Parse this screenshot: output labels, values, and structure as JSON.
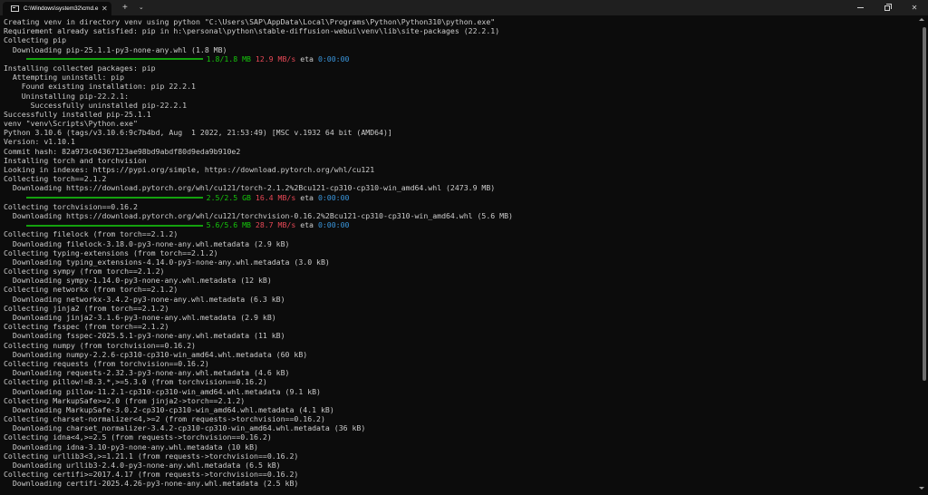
{
  "tab": {
    "title": "C:\\Windows\\system32\\cmd.e"
  },
  "titlebar": {
    "close_glyph": "✕",
    "new_tab_glyph": "+",
    "dropdown_glyph": "⌄",
    "win_close_glyph": "✕"
  },
  "console": {
    "l1": "Creating venv in directory venv using python \"C:\\Users\\SAP\\AppData\\Local\\Programs\\Python\\Python310\\python.exe\"",
    "l2": "Requirement already satisfied: pip in h:\\personal\\python\\stable-diffusion-webui\\venv\\lib\\site-packages (22.2.1)",
    "l3": "Collecting pip",
    "l4": "  Downloading pip-25.1.1-py3-none-any.whl (1.8 MB)",
    "p1": {
      "indent": "     ",
      "done": "1.8/1.8 MB",
      "speed": "12.9 MB/s",
      "eta_label": "eta",
      "eta": "0:00:00"
    },
    "l6": "Installing collected packages: pip",
    "l7": "  Attempting uninstall: pip",
    "l8": "    Found existing installation: pip 22.2.1",
    "l9": "    Uninstalling pip-22.2.1:",
    "l10": "      Successfully uninstalled pip-22.2.1",
    "l11": "Successfully installed pip-25.1.1",
    "l12": "venv \"venv\\Scripts\\Python.exe\"",
    "l13": "Python 3.10.6 (tags/v3.10.6:9c7b4bd, Aug  1 2022, 21:53:49) [MSC v.1932 64 bit (AMD64)]",
    "l14": "Version: v1.10.1",
    "l15": "Commit hash: 82a973c04367123ae98bd9abdf80d9eda9b910e2",
    "l16": "Installing torch and torchvision",
    "l17": "Looking in indexes: https://pypi.org/simple, https://download.pytorch.org/whl/cu121",
    "l18": "Collecting torch==2.1.2",
    "l19": "  Downloading https://download.pytorch.org/whl/cu121/torch-2.1.2%2Bcu121-cp310-cp310-win_amd64.whl (2473.9 MB)",
    "p2": {
      "indent": "     ",
      "done": "2.5/2.5 GB",
      "speed": "16.4 MB/s",
      "eta_label": "eta",
      "eta": "0:00:00"
    },
    "l21": "Collecting torchvision==0.16.2",
    "l22": "  Downloading https://download.pytorch.org/whl/cu121/torchvision-0.16.2%2Bcu121-cp310-cp310-win_amd64.whl (5.6 MB)",
    "p3": {
      "indent": "     ",
      "done": "5.6/5.6 MB",
      "speed": "28.7 MB/s",
      "eta_label": "eta",
      "eta": "0:00:00"
    },
    "l24": "Collecting filelock (from torch==2.1.2)",
    "l25": "  Downloading filelock-3.18.0-py3-none-any.whl.metadata (2.9 kB)",
    "l26": "Collecting typing-extensions (from torch==2.1.2)",
    "l27": "  Downloading typing_extensions-4.14.0-py3-none-any.whl.metadata (3.0 kB)",
    "l28": "Collecting sympy (from torch==2.1.2)",
    "l29": "  Downloading sympy-1.14.0-py3-none-any.whl.metadata (12 kB)",
    "l30": "Collecting networkx (from torch==2.1.2)",
    "l31": "  Downloading networkx-3.4.2-py3-none-any.whl.metadata (6.3 kB)",
    "l32": "Collecting jinja2 (from torch==2.1.2)",
    "l33": "  Downloading jinja2-3.1.6-py3-none-any.whl.metadata (2.9 kB)",
    "l34": "Collecting fsspec (from torch==2.1.2)",
    "l35": "  Downloading fsspec-2025.5.1-py3-none-any.whl.metadata (11 kB)",
    "l36": "Collecting numpy (from torchvision==0.16.2)",
    "l37": "  Downloading numpy-2.2.6-cp310-cp310-win_amd64.whl.metadata (60 kB)",
    "l38": "Collecting requests (from torchvision==0.16.2)",
    "l39": "  Downloading requests-2.32.3-py3-none-any.whl.metadata (4.6 kB)",
    "l40": "Collecting pillow!=8.3.*,>=5.3.0 (from torchvision==0.16.2)",
    "l41": "  Downloading pillow-11.2.1-cp310-cp310-win_amd64.whl.metadata (9.1 kB)",
    "l42": "Collecting MarkupSafe>=2.0 (from jinja2->torch==2.1.2)",
    "l43": "  Downloading MarkupSafe-3.0.2-cp310-cp310-win_amd64.whl.metadata (4.1 kB)",
    "l44": "Collecting charset-normalizer<4,>=2 (from requests->torchvision==0.16.2)",
    "l45": "  Downloading charset_normalizer-3.4.2-cp310-cp310-win_amd64.whl.metadata (36 kB)",
    "l46": "Collecting idna<4,>=2.5 (from requests->torchvision==0.16.2)",
    "l47": "  Downloading idna-3.10-py3-none-any.whl.metadata (10 kB)",
    "l48": "Collecting urllib3<3,>=1.21.1 (from requests->torchvision==0.16.2)",
    "l49": "  Downloading urllib3-2.4.0-py3-none-any.whl.metadata (6.5 kB)",
    "l50": "Collecting certifi>=2017.4.17 (from requests->torchvision==0.16.2)",
    "l51": "  Downloading certifi-2025.4.26-py3-none-any.whl.metadata (2.5 kB)"
  },
  "colors": {
    "background": "#0c0c0c",
    "text": "#cccccc",
    "progress": "#13a10e",
    "speed": "#e74856",
    "eta": "#3a96dd"
  }
}
